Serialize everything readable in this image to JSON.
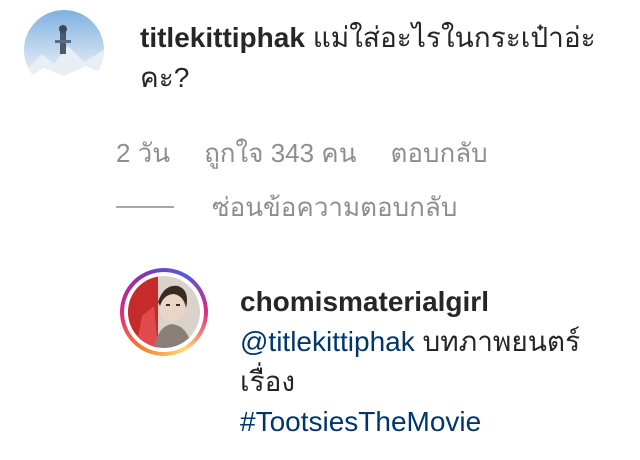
{
  "comment": {
    "username": "titlekittiphak",
    "text": "แม่ใส่อะไรในกระเป๋าอ่ะคะ?",
    "time": "2 วัน",
    "likes_label": "ถูกใจ 343 คน",
    "reply_label": "ตอบกลับ",
    "avatar_icon": "profile-photo-snowy-peak",
    "hide_replies_label": "ซ่อนข้อความตอบกลับ"
  },
  "reply": {
    "username": "chomismaterialgirl",
    "mention": "@titlekittiphak",
    "text": "บทภาพยนตร์เรื่อง",
    "hashtag": "#TootsiesTheMovie",
    "avatar_icon": "profile-photo-story-ring"
  },
  "colors": {
    "text": "#262626",
    "secondary": "#8e8e8e",
    "link": "#00376b"
  }
}
